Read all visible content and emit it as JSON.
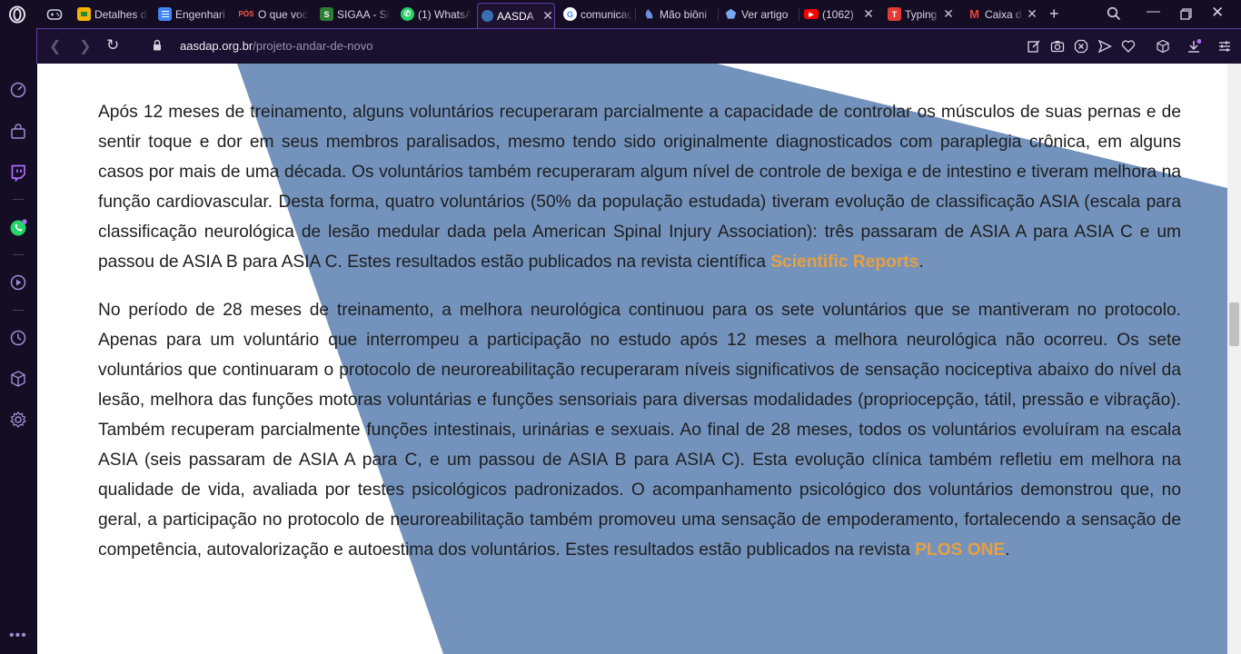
{
  "tabs": [
    {
      "label": "Detalhes d",
      "icon": "classroom-icon",
      "color": "#f4b400"
    },
    {
      "label": "Engenhari",
      "icon": "docs-icon",
      "color": "#4285f4"
    },
    {
      "label": "O que voc",
      "icon": "pos-icon",
      "color": "#e53935"
    },
    {
      "label": "SIGAA - Si",
      "icon": "sigaa-icon",
      "color": "#2e7d32"
    },
    {
      "label": "(1) WhatsA",
      "icon": "whatsapp-icon",
      "color": "#25d366"
    },
    {
      "label": "AASDA",
      "icon": "aasdap-icon",
      "color": "#3a6fb0"
    },
    {
      "label": "comunicaç",
      "icon": "google-icon",
      "color": "#ffffff"
    },
    {
      "label": "Mão biôni",
      "icon": "person-icon",
      "color": "#3b5aa8"
    },
    {
      "label": "Ver artigo",
      "icon": "scholar-icon",
      "color": "#5b8fd8"
    },
    {
      "label": "(1062)",
      "icon": "youtube-icon",
      "color": "#ff0000"
    },
    {
      "label": "Typing",
      "icon": "typing-icon",
      "color": "#e53935"
    },
    {
      "label": "Caixa d",
      "icon": "gmail-icon",
      "color": "#ea4335"
    }
  ],
  "address": {
    "domain": "aasdap.org.br",
    "path": "/projeto-andar-de-novo"
  },
  "content": {
    "p1_text": "Após 12 meses de treinamento, alguns voluntários recuperaram parcialmente a capacidade de controlar os músculos de suas pernas e de sentir toque e dor em seus membros paralisados, mesmo tendo sido originalmente diagnosticados com paraplegia crônica, em alguns casos por mais de uma década. Os voluntários também recuperaram algum nível de controle de bexiga e de intestino e tiveram melhora na função cardiovascular. Desta forma, quatro voluntários (50% da população estudada) tiveram evolução de classificação ASIA (escala para classificação neurológica de lesão medular dada pela American Spinal Injury Association): três passaram de ASIA A para ASIA C e um passou de ASIA B para ASIA C. Estes resultados estão publicados na revista científica ",
    "p1_link": "Scientific Reports",
    "p1_end": ".",
    "p2_text": "No período de 28 meses de treinamento, a melhora neurológica continuou para os sete voluntários que se mantiveram no protocolo. Apenas para um voluntário que interrompeu a participação no estudo após 12 meses a melhora neurológica não ocorreu. Os sete voluntários que continuaram o protocolo de neuroreabilitação recuperaram níveis significativos de sensação nociceptiva abaixo do nível da lesão, melhora das funções motoras voluntárias e funções sensoriais para diversas modalidades (propriocepção, tátil, pressão e vibração). Também recuperam parcialmente funções intestinais, urinárias e sexuais. Ao final de 28 meses, todos os voluntários evoluíram na escala ASIA (seis passaram de ASIA A para C, e um passou de ASIA B para ASIA C). Esta evolução clínica também refletiu em melhora na qualidade de vida, avaliada por testes psicológicos padronizados. O acompanhamento psicológico dos voluntários demonstrou que, no geral, a participação no protocolo de neuroreabilitação também promoveu uma sensação de empoderamento, fortalecendo a sensação de competência, autovalorização e autoestima dos voluntários. Estes resultados estão publicados na revista ",
    "p2_link": "PLOS ONE",
    "p2_end": "."
  },
  "colors": {
    "accent_link": "#e8a040",
    "bg_shape": "#7393bd",
    "browser_bg": "#140d24",
    "active_tab_border": "#5b3fa8"
  }
}
